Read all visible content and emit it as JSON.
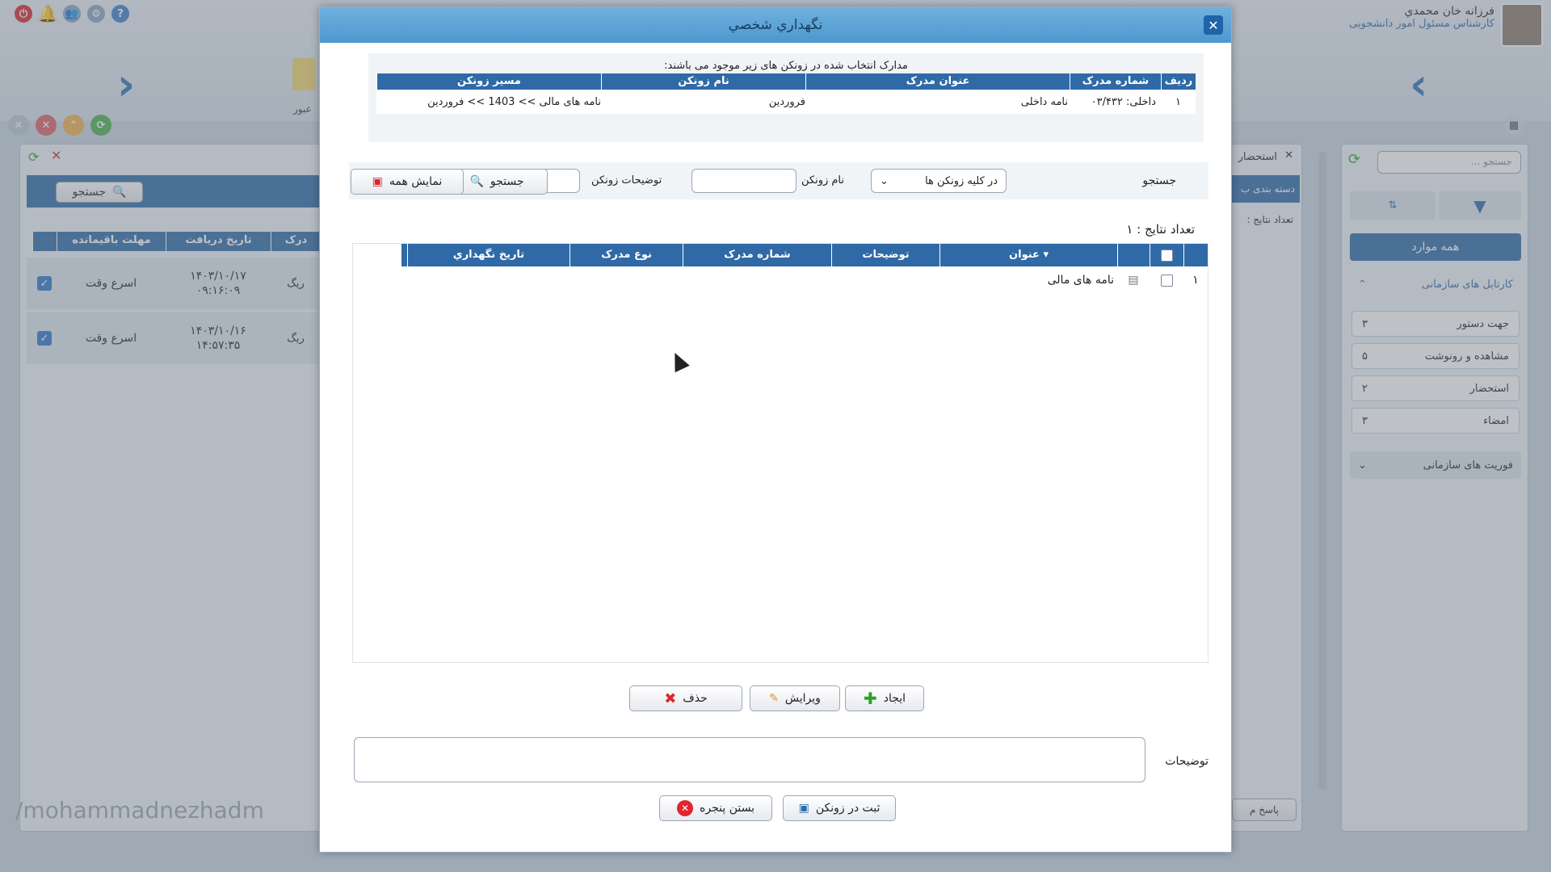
{
  "topbar": {
    "user_name": "فرزانه خان محمدي",
    "user_role": "کارشناس مسئول امور دانشجویی",
    "left_label": "عبور"
  },
  "left_panel": {
    "search_label": "جستجو",
    "columns": [
      "مهلت باقیمانده",
      "تاریخ دریافت",
      "درک"
    ],
    "rows": [
      {
        "deadline": "اسرع وقت",
        "date": "۱۴۰۳/۱۰/۱۷",
        "time": "۰۹:۱۶:۰۹",
        "type": "ریگ"
      },
      {
        "deadline": "اسرع وقت",
        "date": "۱۴۰۳/۱۰/۱۶",
        "time": "۱۴:۵۷:۳۵",
        "type": "ریگ"
      }
    ],
    "watermark": "/mohammadnezhadm"
  },
  "right_panel": {
    "search_placeholder": "جستجو ...",
    "all_items": "همه موارد",
    "section1": "کارتابل های سازمانی",
    "items": [
      {
        "label": "جهت دستور",
        "count": "۳"
      },
      {
        "label": "مشاهده و رونوشت",
        "count": "۵"
      },
      {
        "label": "استحضار",
        "count": "۲"
      },
      {
        "label": "امضاء",
        "count": "۳"
      }
    ],
    "section2": "فوریت های سازمانی"
  },
  "mid_panel": {
    "tab_label": "استحضار",
    "category_label": "دسته بندی ب",
    "count_label": "تعداد نتایج :",
    "reply_label": "پاسخ م"
  },
  "modal": {
    "title": "نگهداري شخصي",
    "notice": "مدارک انتخاب شده در زونکن های زیر موجود می باشند:",
    "top_table": {
      "headers": [
        "ردیف",
        "شماره مدرک",
        "عنوان مدرک",
        "نام زونکن",
        "مسیر زونکن"
      ],
      "rows": [
        {
          "row": "۱",
          "number": "داخلی: ۰۳/۴۳۲",
          "title": "نامه داخلی",
          "binder": "فروردین",
          "path": "نامه های مالی >> 1403 >> فروردین"
        }
      ]
    },
    "search_label": "جستجو",
    "scope_select": "در کلیه زونکن ها",
    "binder_name_label": "نام زونکن",
    "binder_desc_label": "توضیحات زونکن",
    "search_button": "جستجو",
    "show_all_button": "نمایش همه",
    "results_count": "تعداد نتایج : ۱",
    "grid": {
      "headers": [
        "عنوان",
        "توضیحات",
        "شماره مدرک",
        "نوع مدرک",
        "تاریخ نگهداري"
      ],
      "rows": [
        {
          "row": "۱",
          "title": "نامه های مالی",
          "desc": "",
          "number": "",
          "type": "",
          "date": ""
        }
      ]
    },
    "create_button": "ایجاد",
    "edit_button": "ویرایش",
    "delete_button": "حذف",
    "desc_label": "توضیحات",
    "desc_value": "",
    "save_button": "ثبت در زونکن",
    "close_button": "بستن پنجره"
  },
  "colors": {
    "header_blue": "#2f6aa7",
    "accent_red": "#e0262e",
    "accent_green": "#2aa02a"
  }
}
